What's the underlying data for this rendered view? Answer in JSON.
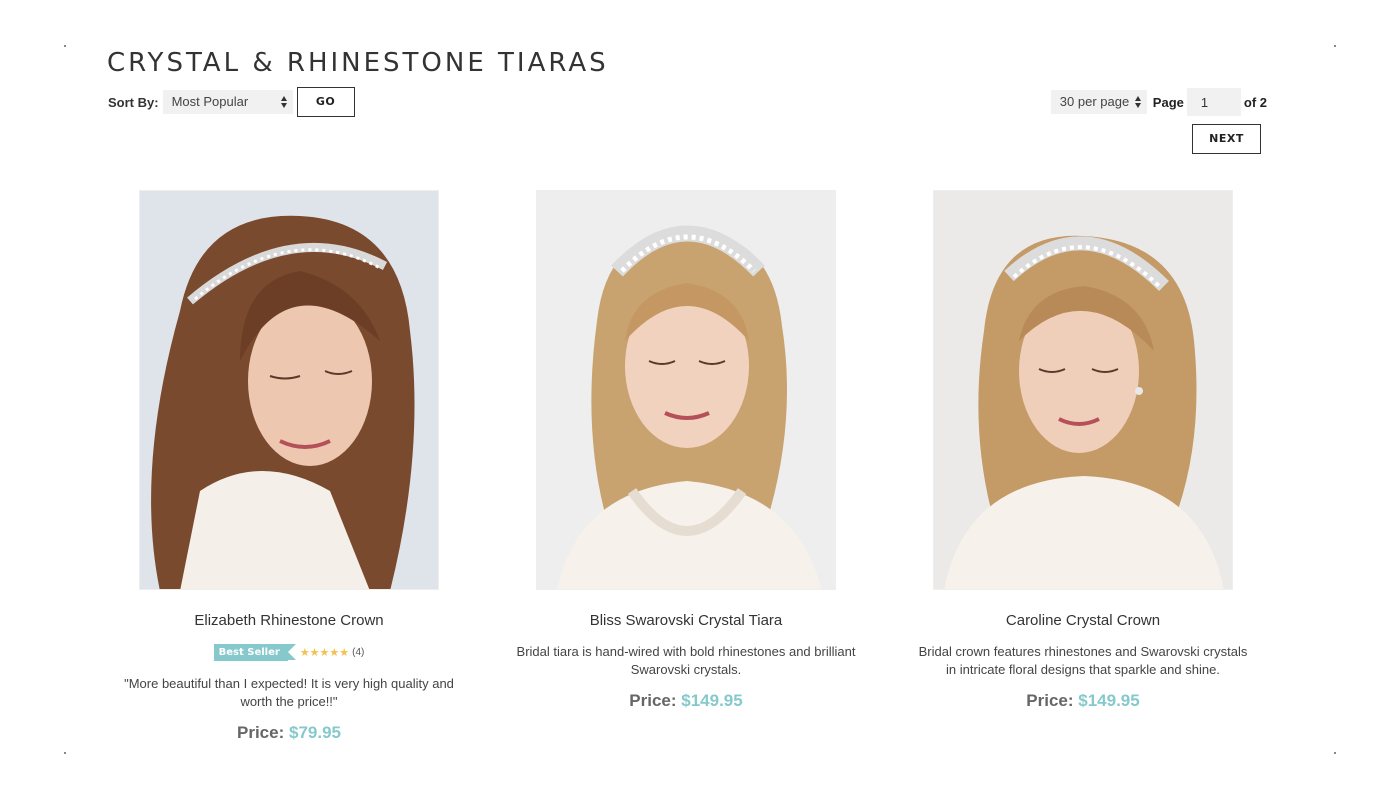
{
  "page": {
    "title": "CRYSTAL & RHINESTONE TIARAS"
  },
  "sort": {
    "label": "Sort By:",
    "selected": "Most Popular",
    "go_label": "GO"
  },
  "paging": {
    "per_page": "30 per page",
    "page_label": "Page",
    "page_value": "1",
    "of_label": "of 2",
    "next_label": "NEXT"
  },
  "products": [
    {
      "name": "Elizabeth Rhinestone Crown",
      "badge": "Best Seller",
      "stars": "★★★★★",
      "rating_count": "(4)",
      "rating": 5,
      "desc": "\"More beautiful than I expected! It is very high quality and worth the price!!\"",
      "price_label": "Price:",
      "price": "$79.95",
      "hair_color": "#7a4a2e",
      "backdrop": "#dfe3ea"
    },
    {
      "name": "Bliss Swarovski Crystal Tiara",
      "desc": "Bridal tiara is hand-wired with bold rhinestones and brilliant Swarovski crystals.",
      "price_label": "Price:",
      "price": "$149.95",
      "hair_color": "#c9a36f",
      "backdrop": "#eeeeee"
    },
    {
      "name": "Caroline Crystal Crown",
      "desc": "Bridal crown features rhinestones and Swarovski crystals in intricate floral designs that sparkle and shine.",
      "price_label": "Price:",
      "price": "$149.95",
      "hair_color": "#c49a66",
      "backdrop": "#eceae8"
    }
  ],
  "colors": {
    "accent": "#86c9cc",
    "star": "#f2c14e",
    "text": "#333333"
  }
}
